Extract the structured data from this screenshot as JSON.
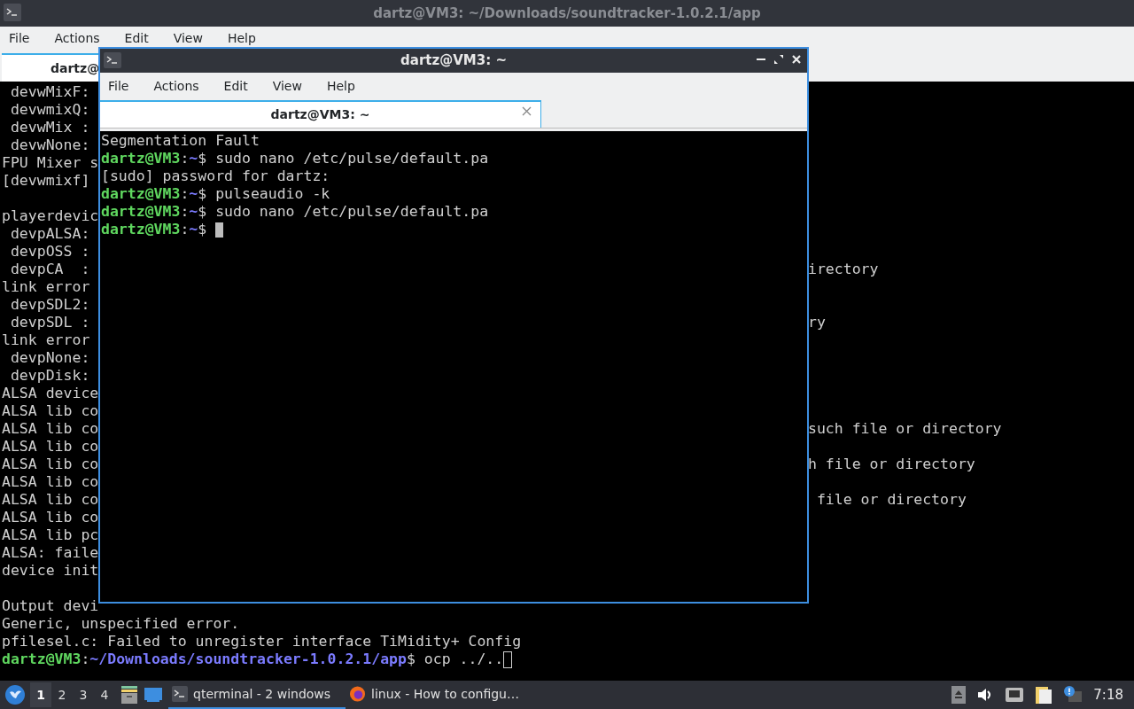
{
  "back_window": {
    "title": "dartz@VM3: ~/Downloads/soundtracker-1.0.2.1/app",
    "menu": [
      "File",
      "Actions",
      "Edit",
      "View",
      "Help"
    ],
    "tab": {
      "label": "dartz@",
      "selected": true
    },
    "lines": [
      {
        "text": " devwMixF:"
      },
      {
        "text": " devwmixQ:"
      },
      {
        "text": " devwMix :"
      },
      {
        "text": " devwNone:"
      },
      {
        "text": "FPU Mixer s"
      },
      {
        "text": "[devwmixf]"
      },
      {
        "kind": "blank"
      },
      {
        "text": "playerdevic"
      },
      {
        "text": " devpALSA:"
      },
      {
        "text": " devpOSS :"
      },
      {
        "text": " devpCA  :",
        "right": "irectory"
      },
      {
        "text": "link error"
      },
      {
        "text": " devpSDL2:"
      },
      {
        "text": " devpSDL :",
        "right": "ry"
      },
      {
        "text": "link error"
      },
      {
        "text": " devpNone:"
      },
      {
        "text": " devpDisk:"
      },
      {
        "text": "ALSA device"
      },
      {
        "text": "ALSA lib co"
      },
      {
        "text": "ALSA lib co",
        "right": "such file or directory"
      },
      {
        "text": "ALSA lib co"
      },
      {
        "text": "ALSA lib co",
        "right": "h file or directory"
      },
      {
        "text": "ALSA lib co"
      },
      {
        "text": "ALSA lib co",
        "right": " file or directory"
      },
      {
        "text": "ALSA lib co"
      },
      {
        "text": "ALSA lib pc"
      },
      {
        "text": "ALSA: faile"
      },
      {
        "text": "device init"
      },
      {
        "kind": "blank"
      },
      {
        "text": "Output devi"
      },
      {
        "text": "Generic, unspecified error."
      },
      {
        "text": "pfilesel.c: Failed to unregister interface TiMidity+ Config"
      }
    ],
    "prompt": {
      "user": "dartz@VM3",
      "separator": ":",
      "path": "~/Downloads/soundtracker-1.0.2.1/app",
      "command": "$ ocp ../..",
      "cursor": true,
      "cursor_filled": false
    }
  },
  "front_window": {
    "title": "dartz@VM3: ~",
    "menu": [
      "File",
      "Actions",
      "Edit",
      "View",
      "Help"
    ],
    "tab": {
      "label": "dartz@VM3: ~",
      "selected": true
    },
    "lines": [
      {
        "kind": "output",
        "text": "Segmentation Fault"
      },
      {
        "kind": "prompt",
        "user": "dartz@VM3",
        "separator": ":",
        "path": "~",
        "command": "$ sudo nano /etc/pulse/default.pa",
        "cursor": false
      },
      {
        "kind": "output",
        "text": "[sudo] password for dartz:"
      },
      {
        "kind": "prompt",
        "user": "dartz@VM3",
        "separator": ":",
        "path": "~",
        "command": "$ pulseaudio -k",
        "cursor": false
      },
      {
        "kind": "prompt",
        "user": "dartz@VM3",
        "separator": ":",
        "path": "~",
        "command": "$ sudo nano /etc/pulse/default.pa",
        "cursor": false
      },
      {
        "kind": "prompt",
        "user": "dartz@VM3",
        "separator": ":",
        "path": "~",
        "command": "$",
        "cursor": true,
        "cursor_filled": true
      }
    ]
  },
  "taskbar": {
    "workspaces": [
      {
        "label": "1",
        "selected": true
      },
      {
        "label": "2",
        "selected": false
      },
      {
        "label": "3",
        "selected": false
      },
      {
        "label": "4",
        "selected": false
      }
    ],
    "tasks": [
      {
        "kind": "terminal",
        "label": "qterminal - 2 windows",
        "selected": true
      },
      {
        "kind": "browser",
        "label": "linux - How to configu…",
        "selected": false
      }
    ],
    "clock": "7:18"
  }
}
